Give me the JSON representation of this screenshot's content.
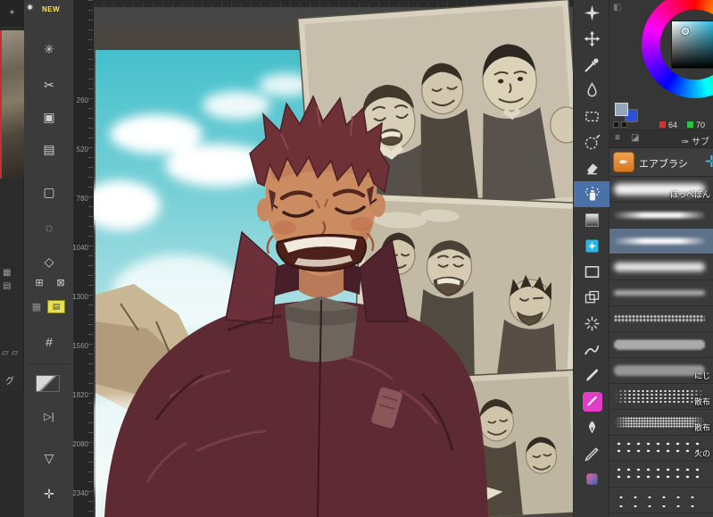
{
  "navigator": {
    "icon_top": "✦",
    "mid_icons": [
      "▦",
      "▤"
    ],
    "folder_icons": [
      "▱",
      "▱"
    ],
    "palette_label": "グ"
  },
  "left_toolbar": {
    "new_badge": "NEW",
    "icons": [
      {
        "name": "decoration-new-icon",
        "glyph": "✷"
      },
      {
        "name": "operation-tool-icon",
        "glyph": "✳"
      },
      {
        "name": "scissors-icon",
        "glyph": "✂"
      },
      {
        "name": "copy-icon",
        "glyph": "▣"
      },
      {
        "name": "document-icon",
        "glyph": "▤"
      },
      {
        "name": "marquee-select-icon",
        "glyph": "▢"
      },
      {
        "name": "lasso-select-icon",
        "glyph": "◌"
      },
      {
        "name": "polygon-select-icon",
        "glyph": "◇"
      },
      {
        "name": "transform-a-icon",
        "glyph": "⊞"
      },
      {
        "name": "transform-b-icon",
        "glyph": "⊠"
      },
      {
        "name": "layer-highlight-icon",
        "glyph": "▤"
      },
      {
        "name": "mesh-icon",
        "glyph": "#"
      },
      {
        "name": "skip-icon",
        "glyph": "▷|"
      },
      {
        "name": "triangle-icon",
        "glyph": "▽"
      },
      {
        "name": "move-canvas-icon",
        "glyph": "✛"
      }
    ]
  },
  "ruler": {
    "ticks": [
      "260",
      "520",
      "780",
      "1040",
      "1300",
      "1560",
      "1820",
      "2080",
      "2340"
    ]
  },
  "right_toolbar": {
    "selected_index": 7,
    "tools": [
      {
        "name": "decoration-tool"
      },
      {
        "name": "move-tool"
      },
      {
        "name": "eyedropper-tool"
      },
      {
        "name": "fill-tool"
      },
      {
        "name": "marquee-tool"
      },
      {
        "name": "auto-select-tool"
      },
      {
        "name": "eraser-tool"
      },
      {
        "name": "airbrush-tool"
      },
      {
        "name": "gradient-tool"
      },
      {
        "name": "effect-tool"
      },
      {
        "name": "figure-tool"
      },
      {
        "name": "frame-tool"
      },
      {
        "name": "stream-line-tool"
      },
      {
        "name": "selection-pen-tool"
      },
      {
        "name": "pen-tool"
      },
      {
        "name": "marker-tool"
      },
      {
        "name": "nib-tool"
      },
      {
        "name": "pencil-tool"
      },
      {
        "name": "subtool-extra"
      }
    ]
  },
  "color_panel": {
    "r_value": "64",
    "g_value": "70",
    "main_color": "#93a7b9",
    "sub_color": "#2e4fd8",
    "sv_gradient_color": "#17b4dd"
  },
  "subtool_panel": {
    "tab_menu_icon": "≡",
    "tab_brush_icon": "◪",
    "tab_label": "✑ サブ",
    "tool_icon": "✒",
    "tool_label": "エアブラシ",
    "next_group_icon": "✛"
  },
  "brushes": {
    "selected_index": 2,
    "items": [
      {
        "label": "ほっぺぽん",
        "style": "soft-thick"
      },
      {
        "label": "",
        "style": "taper"
      },
      {
        "label": "",
        "style": "taper"
      },
      {
        "label": "",
        "style": "soft"
      },
      {
        "label": "",
        "style": "thin"
      },
      {
        "label": "",
        "style": "rough"
      },
      {
        "label": "",
        "style": "grain"
      },
      {
        "label": "にじ",
        "style": "grain-soft"
      },
      {
        "label": "散布",
        "style": "spray"
      },
      {
        "label": "散布",
        "style": "spray-fine"
      },
      {
        "label": "火の",
        "style": "dots"
      },
      {
        "label": "",
        "style": "dots"
      },
      {
        "label": "",
        "style": "dots-sparse"
      }
    ]
  },
  "accents": {
    "selection_blue": "#4a72a8",
    "marker_pink": "#e23cc8",
    "tool_orange": "#e8913d",
    "layer_yellow": "#e8e24a",
    "navigator_red_edge": "#c23232"
  }
}
